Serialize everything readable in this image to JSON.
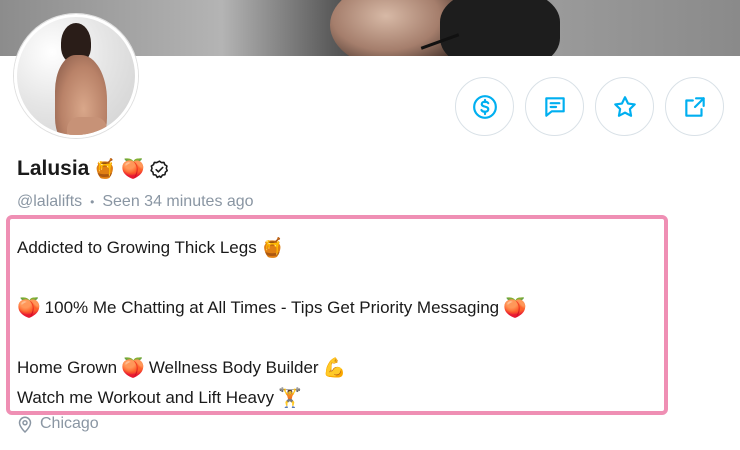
{
  "profile": {
    "display_name": "Lalusia",
    "name_emojis": [
      "🍯",
      "🍑"
    ],
    "username": "@lalalifts",
    "last_seen": "Seen 34 minutes ago",
    "location": "Chicago"
  },
  "bio": {
    "line1_text": "Addicted to Growing Thick Legs",
    "line1_emoji": "🍯",
    "line2_emoji_start": "🍑",
    "line2_text": "100% Me Chatting at All Times - Tips Get Priority Messaging",
    "line2_emoji_end": "🍑",
    "line3_text_a": "Home Grown",
    "line3_emoji_a": "🍑",
    "line3_text_b": "Wellness Body Builder",
    "line3_emoji_b": "💪",
    "line4_text": "Watch me Workout and Lift Heavy",
    "line4_emoji": "🏋️"
  },
  "actions": [
    {
      "icon": "dollar-circle-icon"
    },
    {
      "icon": "message-icon"
    },
    {
      "icon": "star-icon"
    },
    {
      "icon": "share-icon"
    }
  ],
  "colors": {
    "accent": "#00aff0",
    "muted_text": "#8a96a3",
    "highlight_border": "#ef8fb4"
  }
}
